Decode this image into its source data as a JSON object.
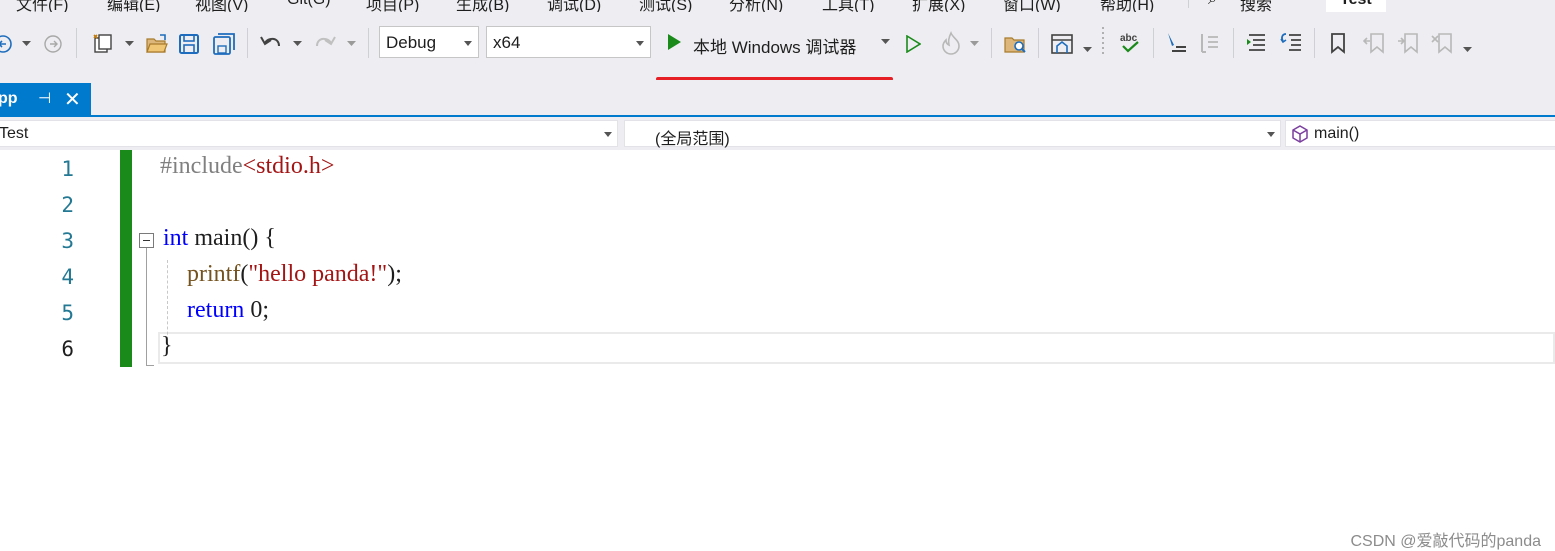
{
  "menu": {
    "items": [
      "文件(F)",
      "编辑(E)",
      "视图(V)",
      "Git(G)",
      "项目(P)",
      "生成(B)",
      "调试(D)",
      "测试(S)",
      "分析(N)",
      "工具(T)",
      "扩展(X)",
      "窗口(W)",
      "帮助(H)"
    ],
    "search_label": "搜索",
    "solution_name": "Test"
  },
  "toolbar": {
    "configuration": "Debug",
    "platform": "x64",
    "debugger_label": "本地 Windows 调试器",
    "icons": [
      "back-icon",
      "forward-icon",
      "new-project-icon",
      "open-folder-icon",
      "save-icon",
      "save-all-icon",
      "undo-icon",
      "redo-icon",
      "start-debugging-icon",
      "start-without-debugging-icon",
      "hot-reload-icon",
      "solution-explorer-icon",
      "home-icon",
      "spell-check-icon",
      "comment-icon",
      "indent-icon",
      "bookmark-icon"
    ]
  },
  "tab": {
    "name": "pp",
    "pin": "⊣",
    "close": "✕",
    "active_color": "#007acc"
  },
  "navbar": {
    "project": "Test",
    "scope": "(全局范围)",
    "member": "main()"
  },
  "editor": {
    "line_numbers": [
      "1",
      "2",
      "3",
      "4",
      "5",
      "6"
    ],
    "lines": [
      [
        {
          "t": "#include",
          "c": "pp"
        },
        {
          "t": "<stdio.h>",
          "c": "inc"
        }
      ],
      [],
      [
        {
          "t": "int",
          "c": "kw"
        },
        {
          "t": " main() {",
          "c": ""
        }
      ],
      [
        {
          "t": "    ",
          "c": ""
        },
        {
          "t": "printf",
          "c": "fn"
        },
        {
          "t": "(",
          "c": ""
        },
        {
          "t": "\"hello panda!\"",
          "c": "str"
        },
        {
          "t": ");",
          "c": ""
        }
      ],
      [
        {
          "t": "    ",
          "c": ""
        },
        {
          "t": "return",
          "c": "kw"
        },
        {
          "t": " 0;",
          "c": ""
        }
      ],
      [
        {
          "t": "}",
          "c": ""
        }
      ]
    ],
    "change_bar_color": "#1a8b1a"
  },
  "watermark": "CSDN @爱敲代码的panda",
  "colors": {
    "chrome_bg": "#eeeef2",
    "highlight_underline": "#e61f27",
    "run_green": "#1a8b1a"
  }
}
